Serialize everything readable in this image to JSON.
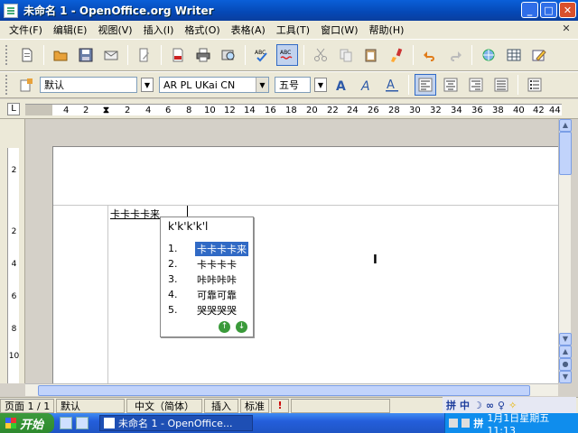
{
  "window": {
    "title": "未命名 1 - OpenOffice.org Writer",
    "minimize": "_",
    "maximize": "□",
    "close": "✕"
  },
  "menu": {
    "items": [
      "文件(F)",
      "编辑(E)",
      "视图(V)",
      "插入(I)",
      "格式(O)",
      "表格(A)",
      "工具(T)",
      "窗口(W)",
      "帮助(H)"
    ],
    "close_doc": "✕"
  },
  "format_bar": {
    "paragraph_style": "默认",
    "font_name": "AR PL UKai CN",
    "font_size": "五号"
  },
  "ruler": {
    "corner": "L",
    "ticks": [
      "4",
      "2",
      "2",
      "4",
      "6",
      "8",
      "10",
      "12",
      "14",
      "16",
      "18",
      "20",
      "22",
      "24",
      "26",
      "28",
      "30",
      "32",
      "34",
      "36",
      "38",
      "40",
      "42",
      "44"
    ]
  },
  "vruler": {
    "ticks": [
      "2",
      "2",
      "4",
      "6",
      "8",
      "10"
    ]
  },
  "document": {
    "typed_text": "卡卡卡卡来"
  },
  "ime_popup": {
    "composition": "k'k'k'k'l",
    "candidates": [
      {
        "num": "1.",
        "text": "卡卡卡卡来",
        "selected": true
      },
      {
        "num": "2.",
        "text": "卡卡卡卡",
        "selected": false
      },
      {
        "num": "3.",
        "text": "咔咔咔咔",
        "selected": false
      },
      {
        "num": "4.",
        "text": "可靠可靠",
        "selected": false
      },
      {
        "num": "5.",
        "text": "哭哭哭哭",
        "selected": false
      }
    ],
    "prev": "↑",
    "next": "↓"
  },
  "statusbar": {
    "page": "页面 1 / 1",
    "style": "默认",
    "language": "中文（简体）",
    "insert_mode": "插入",
    "selection_mode": "标准",
    "modified": "!"
  },
  "ime_bar": {
    "items": [
      "拼",
      "中",
      "☽",
      "∞",
      "♀",
      "✧"
    ]
  },
  "taskbar": {
    "start": "开始",
    "task_title": "未命名 1 - OpenOffice...",
    "tray_text": "1月1日星期五 11:13",
    "tray_ime": "拼"
  },
  "colors": {
    "title_bar": "#0548b5",
    "selection": "#316ac5",
    "start_button": "#2f8a2f"
  }
}
